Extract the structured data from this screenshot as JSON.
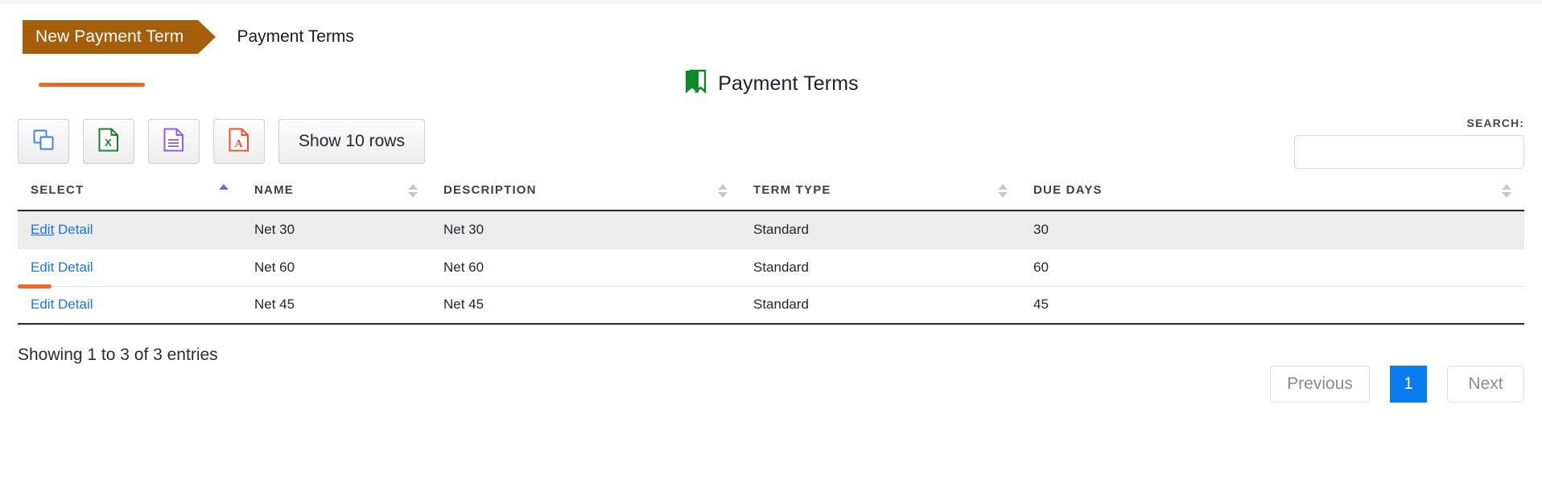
{
  "breadcrumb": {
    "active_tab": "New Payment Term",
    "current": "Payment Terms"
  },
  "page": {
    "title": "Payment Terms",
    "title_icon": "bookmark-icon",
    "accent_color": "#f26522",
    "tab_color": "#a55f0a"
  },
  "toolbar": {
    "buttons": [
      {
        "name": "copy-button",
        "icon": "copy-icon",
        "color": "#3d7fe8"
      },
      {
        "name": "excel-export-button",
        "icon": "excel-file-icon",
        "color": "#1f7a32"
      },
      {
        "name": "csv-export-button",
        "icon": "document-file-icon",
        "color": "#8b5cf6"
      },
      {
        "name": "pdf-export-button",
        "icon": "pdf-file-icon",
        "color": "#f4522f"
      }
    ],
    "show_rows_label": "Show 10 rows"
  },
  "search": {
    "label": "SEARCH:",
    "value": "",
    "placeholder": ""
  },
  "table": {
    "columns": [
      {
        "label": "SELECT",
        "sort": "asc"
      },
      {
        "label": "NAME",
        "sort": "none"
      },
      {
        "label": "DESCRIPTION",
        "sort": "none"
      },
      {
        "label": "TERM TYPE",
        "sort": "none"
      },
      {
        "label": "DUE DAYS",
        "sort": "none"
      }
    ],
    "rows": [
      {
        "edit": "Edit",
        "detail": "Detail",
        "name": "Net 30",
        "description": "Net 30",
        "term_type": "Standard",
        "due_days": "30"
      },
      {
        "edit": "Edit",
        "detail": "Detail",
        "name": "Net 60",
        "description": "Net 60",
        "term_type": "Standard",
        "due_days": "60"
      },
      {
        "edit": "Edit",
        "detail": "Detail",
        "name": "Net 45",
        "description": "Net 45",
        "term_type": "Standard",
        "due_days": "45"
      }
    ]
  },
  "footer": {
    "showing": "Showing 1 to 3 of 3 entries",
    "previous": "Previous",
    "page_number": "1",
    "next": "Next"
  }
}
